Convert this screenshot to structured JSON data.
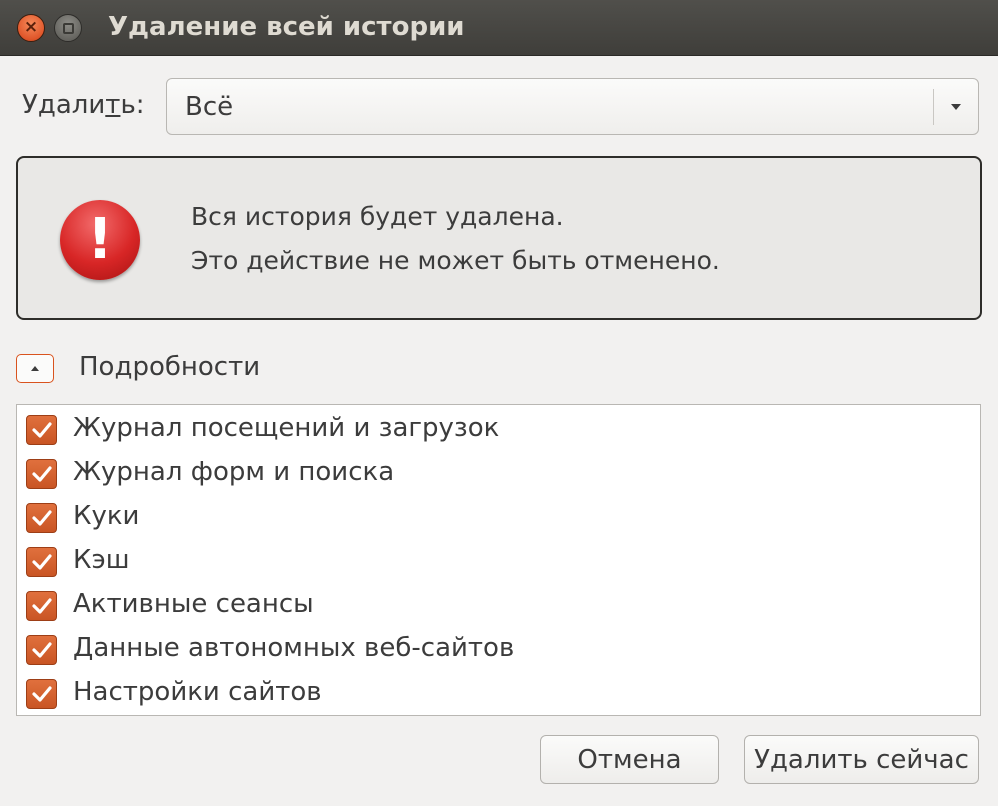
{
  "window": {
    "title": "Удаление всей истории",
    "close_glyph": "×"
  },
  "range": {
    "label_prefix": "Удали",
    "label_mnemonic": "т",
    "label_suffix": "ь:",
    "selected": "Всё"
  },
  "warning": {
    "icon": "exclamation-icon",
    "icon_glyph": "!",
    "line1": "Вся история будет удалена.",
    "line2": "Это действие не может быть отменено."
  },
  "details": {
    "label_prefix": "По",
    "label_mnemonic": "д",
    "label_suffix": "робности",
    "expanded": true
  },
  "items": [
    {
      "label": "Журнал посещений и загрузок",
      "checked": true
    },
    {
      "label": "Журнал форм и поиска",
      "checked": true
    },
    {
      "label": "Куки",
      "checked": true
    },
    {
      "label": "Кэш",
      "checked": true
    },
    {
      "label": "Активные сеансы",
      "checked": true
    },
    {
      "label": "Данные автономных веб-сайтов",
      "checked": true
    },
    {
      "label": "Настройки сайтов",
      "checked": true
    }
  ],
  "buttons": {
    "cancel": "Отмена",
    "delete_now": "Удалить сейчас"
  },
  "colors": {
    "accent": "#dd5827",
    "titlebar": "#46453f",
    "warning_icon": "#d82626"
  }
}
